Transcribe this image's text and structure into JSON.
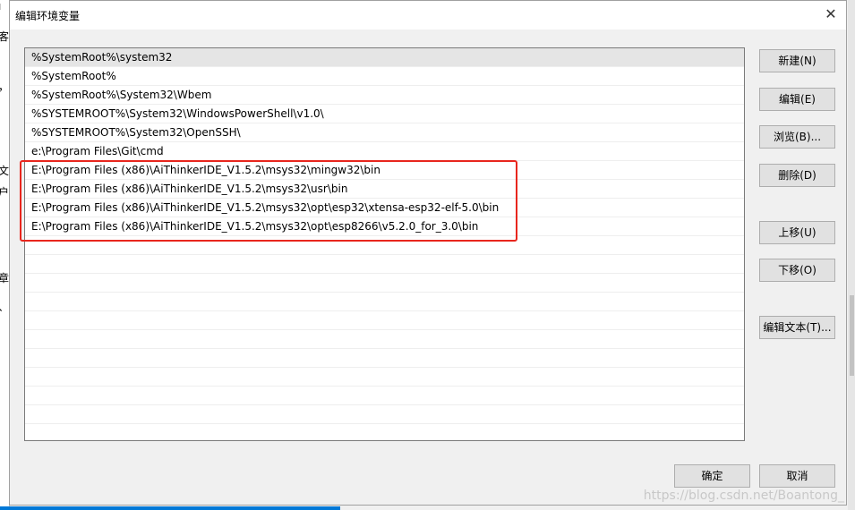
{
  "dialog": {
    "title": "编辑环境变量",
    "close_glyph": "✕"
  },
  "paths": [
    "%SystemRoot%\\system32",
    "%SystemRoot%",
    "%SystemRoot%\\System32\\Wbem",
    "%SYSTEMROOT%\\System32\\WindowsPowerShell\\v1.0\\",
    "%SYSTEMROOT%\\System32\\OpenSSH\\",
    "e:\\Program Files\\Git\\cmd",
    "E:\\Program Files (x86)\\AiThinkerIDE_V1.5.2\\msys32\\mingw32\\bin",
    "E:\\Program Files (x86)\\AiThinkerIDE_V1.5.2\\msys32\\usr\\bin",
    "E:\\Program Files (x86)\\AiThinkerIDE_V1.5.2\\msys32\\opt\\esp32\\xtensa-esp32-elf-5.0\\bin",
    "E:\\Program Files (x86)\\AiThinkerIDE_V1.5.2\\msys32\\opt\\esp8266\\v5.2.0_for_3.0\\bin",
    "",
    "",
    "",
    "",
    "",
    "",
    "",
    "",
    "",
    "",
    ""
  ],
  "buttons": {
    "new": "新建(N)",
    "edit": "编辑(E)",
    "browse": "浏览(B)...",
    "delete": "删除(D)",
    "move_up": "上移(U)",
    "move_down": "下移(O)",
    "edit_text": "编辑文本(T)...",
    "ok": "确定",
    "cancel": "取消"
  },
  "background": {
    "left_chars": [
      "ı",
      "客",
      "，",
      "文",
      "户",
      "章",
      "、"
    ]
  },
  "watermark": "https://blog.csdn.net/Boantong_",
  "colors": {
    "highlight": "#e8261d",
    "accent": "#0078d7"
  }
}
